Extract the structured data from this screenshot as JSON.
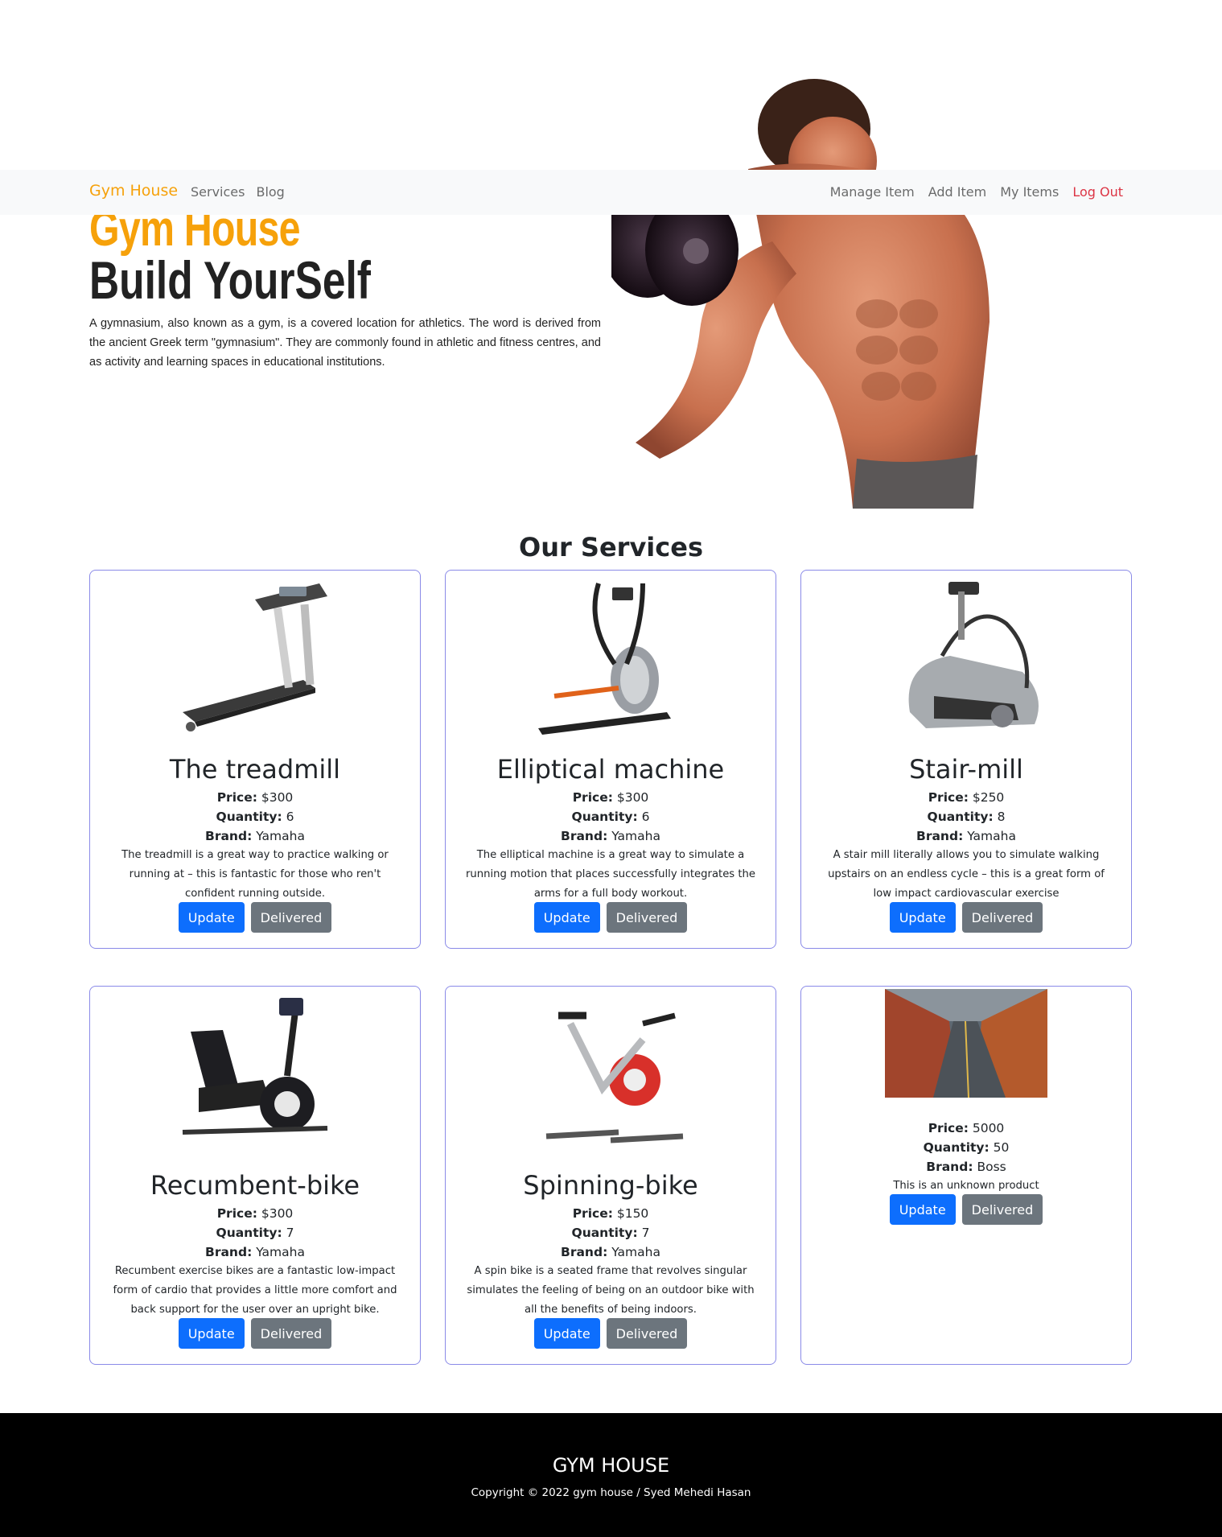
{
  "navbar": {
    "brand": "Gym House",
    "left_links": [
      "Services",
      "Blog"
    ],
    "right_links": [
      "Manage Item",
      "Add Item",
      "My Items"
    ],
    "logout": "Log Out"
  },
  "hero": {
    "title": "Gym House",
    "subtitle": "Build YourSelf",
    "text": "A gymnasium, also known as a gym, is a covered location for athletics. The word is derived from the ancient Greek term \"gymnasium\". They are commonly found in athletic and fitness centres, and as activity and learning spaces in educational institutions."
  },
  "services": {
    "title": "Our Services",
    "labels": {
      "price": "Price:",
      "quantity": "Quantity:",
      "brand": "Brand:"
    },
    "update_label": "Update",
    "delivered_label": "Delivered",
    "items": [
      {
        "name": "The treadmill",
        "price": "$300",
        "quantity": "6",
        "brand": "Yamaha",
        "description": "The treadmill is a great way to practice walking or running at – this is fantastic for those who ren't confident running outside.",
        "image": "treadmill"
      },
      {
        "name": "Elliptical machine",
        "price": "$300",
        "quantity": "6",
        "brand": "Yamaha",
        "description": "The elliptical machine is a great way to simulate a running motion that places successfully integrates the arms for a full body workout.",
        "image": "elliptical"
      },
      {
        "name": "Stair-mill",
        "price": "$250",
        "quantity": "8",
        "brand": "Yamaha",
        "description": "A stair mill literally allows you to simulate walking upstairs on an endless cycle – this is a great form of low impact cardiovascular exercise",
        "image": "stairmill"
      },
      {
        "name": "Recumbent-bike",
        "price": "$300",
        "quantity": "7",
        "brand": "Yamaha",
        "description": "Recumbent exercise bikes are a fantastic low-impact form of cardio that provides a little more comfort and back support for the user over an upright bike.",
        "image": "recumbent"
      },
      {
        "name": "Spinning-bike",
        "price": "$150",
        "quantity": "7",
        "brand": "Yamaha",
        "description": "A spin bike is a seated frame that revolves singular simulates the feeling of being on an outdoor bike with all the benefits of being indoors.",
        "image": "spinbike"
      },
      {
        "name": "",
        "price": "5000",
        "quantity": "50",
        "brand": "Boss",
        "description": "This is an unknown product",
        "image": "road-photo"
      }
    ]
  },
  "footer": {
    "title": "GYM HOUSE",
    "copyright": "Copyright © 2022 gym house / Syed Mehedi Hasan"
  },
  "colors": {
    "accent": "#f6a10a",
    "primary": "#0d6efd",
    "secondary": "#6c757d",
    "danger": "#dc3545",
    "card_border": "#8a8ae8"
  }
}
